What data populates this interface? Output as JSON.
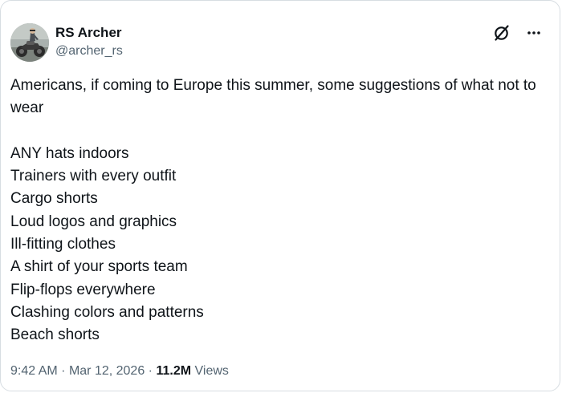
{
  "author": {
    "display_name": "RS Archer",
    "handle": "@archer_rs",
    "avatar": "motorcycle-rider-avatar"
  },
  "tweet": {
    "intro": "Americans, if coming to Europe this summer, some suggestions of what not to wear",
    "items": [
      "ANY hats indoors",
      "Trainers with every outfit",
      "Cargo shorts",
      "Loud logos and graphics",
      "Ill-fitting clothes",
      "A shirt of your sports team",
      "Flip-flops everywhere",
      "Clashing colors and patterns",
      "Beach shorts"
    ]
  },
  "meta": {
    "time": "9:42 AM",
    "separator": "·",
    "date": "Mar 12, 2026",
    "views_count": "11.2M",
    "views_label": "Views"
  },
  "icons": {
    "grok": "grok-icon",
    "more": "more-icon"
  },
  "colors": {
    "text": "#0f1419",
    "secondary": "#536471",
    "border": "#d7dde2"
  }
}
